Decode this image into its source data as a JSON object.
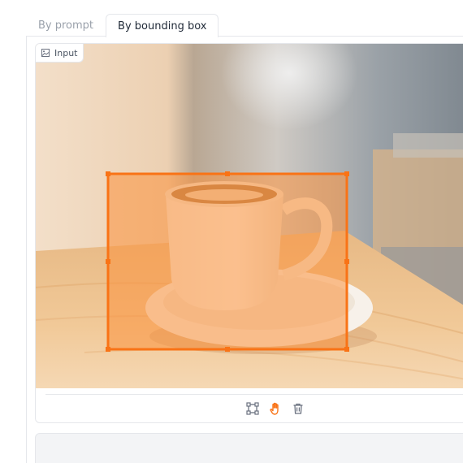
{
  "tabs": [
    {
      "label": "By prompt",
      "active": false
    },
    {
      "label": "By bounding box",
      "active": true
    }
  ],
  "editor": {
    "label": "Input",
    "tools": [
      {
        "name": "bounding-box",
        "icon": "bbox-icon",
        "active": false
      },
      {
        "name": "pan",
        "icon": "hand-icon",
        "active": true
      },
      {
        "name": "delete",
        "icon": "trash-icon",
        "active": false
      }
    ]
  },
  "colors": {
    "accent": "#f97316",
    "selection_fill": "#fdba74",
    "tab_inactive": "#9aa1ab",
    "border": "#e5e7eb"
  }
}
